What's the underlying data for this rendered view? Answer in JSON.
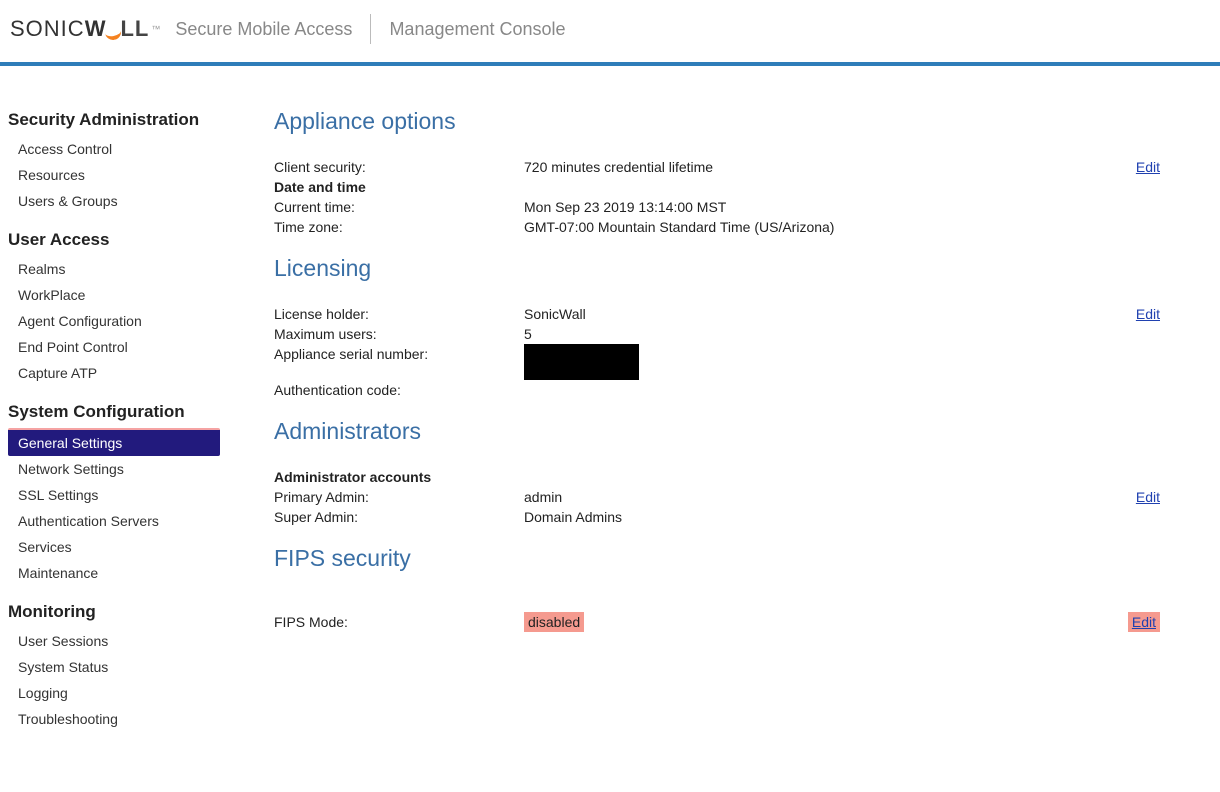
{
  "header": {
    "brand_sonic": "SONIC",
    "brand_wall": "WALL",
    "tm": "™",
    "tag1": "Secure Mobile Access",
    "tag2": "Management Console"
  },
  "sidebar": {
    "groups": [
      {
        "title": "Security Administration",
        "items": [
          {
            "label": "Access Control",
            "active": false
          },
          {
            "label": "Resources",
            "active": false
          },
          {
            "label": "Users & Groups",
            "active": false
          }
        ]
      },
      {
        "title": "User Access",
        "items": [
          {
            "label": "Realms",
            "active": false
          },
          {
            "label": "WorkPlace",
            "active": false
          },
          {
            "label": "Agent Configuration",
            "active": false
          },
          {
            "label": "End Point Control",
            "active": false
          },
          {
            "label": "Capture ATP",
            "active": false
          }
        ]
      },
      {
        "title": "System Configuration",
        "items": [
          {
            "label": "General Settings",
            "active": true
          },
          {
            "label": "Network Settings",
            "active": false
          },
          {
            "label": "SSL Settings",
            "active": false
          },
          {
            "label": "Authentication Servers",
            "active": false
          },
          {
            "label": "Services",
            "active": false
          },
          {
            "label": "Maintenance",
            "active": false
          }
        ]
      },
      {
        "title": "Monitoring",
        "items": [
          {
            "label": "User Sessions",
            "active": false
          },
          {
            "label": "System Status",
            "active": false
          },
          {
            "label": "Logging",
            "active": false
          },
          {
            "label": "Troubleshooting",
            "active": false
          }
        ]
      }
    ]
  },
  "main": {
    "appliance": {
      "title": "Appliance options",
      "clientSecurityLabel": "Client security:",
      "clientSecurityValue": "720 minutes credential lifetime",
      "dateTimeLabel": "Date and time",
      "currentTimeLabel": "Current time:",
      "currentTimeValue": "Mon Sep 23 2019 13:14:00 MST",
      "timeZoneLabel": "Time zone:",
      "timeZoneValue": "GMT-07:00 Mountain Standard Time (US/Arizona)",
      "edit": "Edit"
    },
    "licensing": {
      "title": "Licensing",
      "holderLabel": "License holder:",
      "holderValue": "SonicWall",
      "maxUsersLabel": "Maximum users:",
      "maxUsersValue": "5",
      "serialLabel": "Appliance serial number:",
      "authCodeLabel": "Authentication code:",
      "edit": "Edit"
    },
    "administrators": {
      "title": "Administrators",
      "accountsLabel": "Administrator accounts",
      "primaryLabel": "Primary Admin:",
      "primaryValue": "admin",
      "superLabel": "Super Admin:",
      "superValue": "Domain Admins",
      "edit": "Edit"
    },
    "fips": {
      "title": "FIPS security",
      "modeLabel": "FIPS Mode:",
      "modeValue": "disabled",
      "edit": "Edit"
    }
  }
}
